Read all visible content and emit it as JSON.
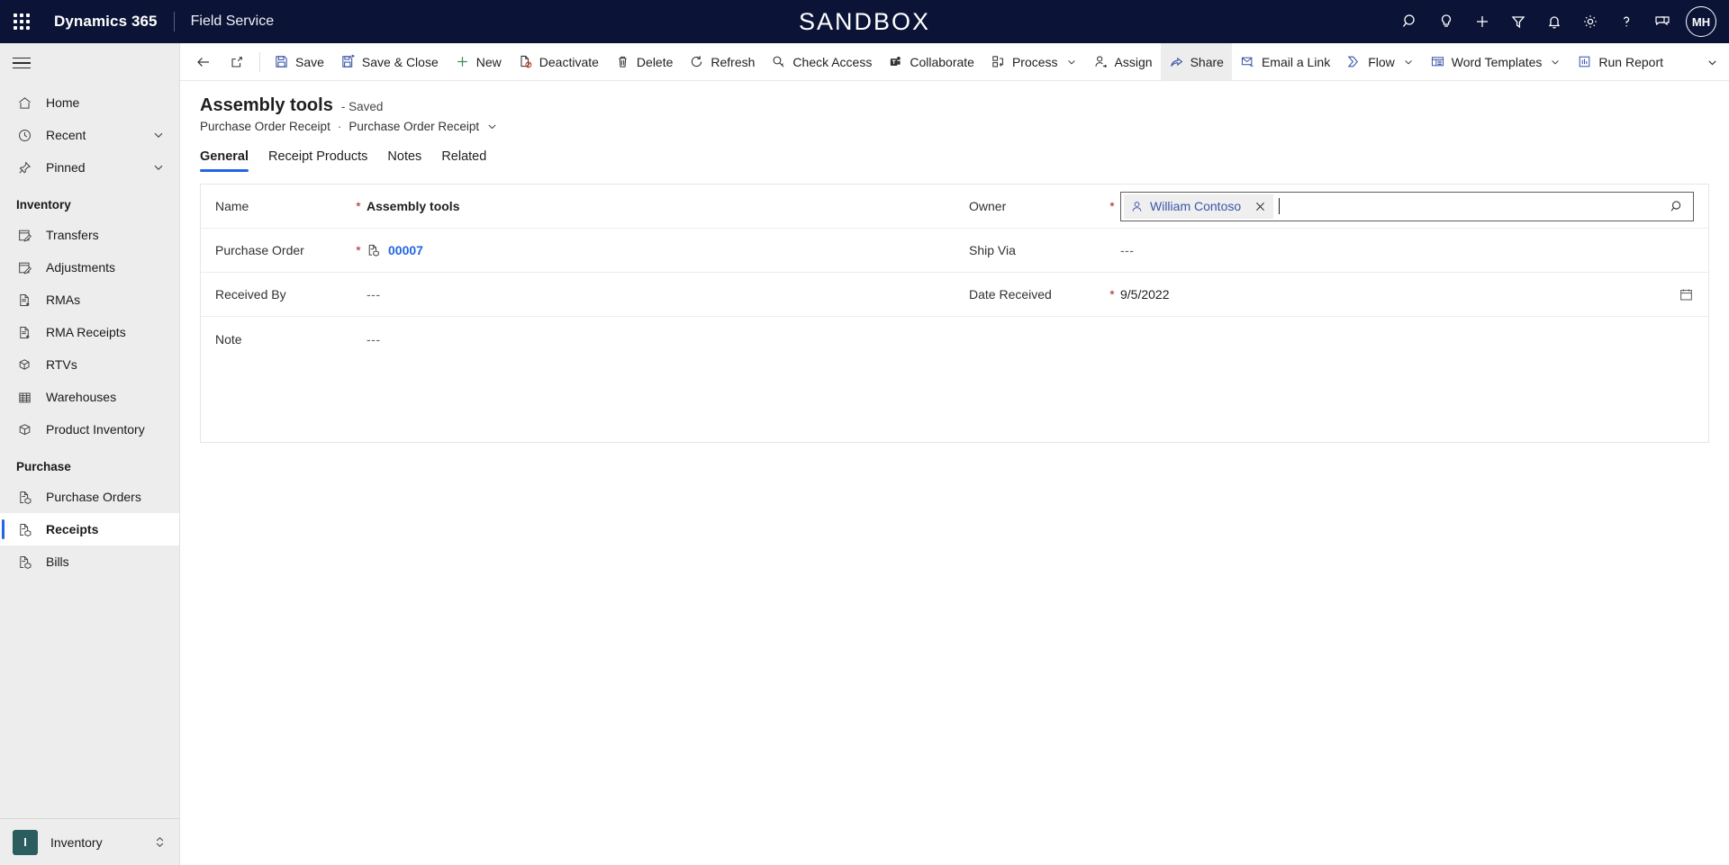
{
  "header": {
    "waffle": "app-launcher",
    "brand": "Dynamics 365",
    "app_name": "Field Service",
    "environment_banner": "SANDBOX",
    "icons": [
      {
        "name": "search-icon",
        "label": "Search"
      },
      {
        "name": "lightbulb-icon",
        "label": "Insights"
      },
      {
        "name": "plus-icon",
        "label": "Quick create"
      },
      {
        "name": "filter-icon",
        "label": "Filter"
      },
      {
        "name": "bell-icon",
        "label": "Notifications"
      },
      {
        "name": "gear-icon",
        "label": "Settings"
      },
      {
        "name": "question-icon",
        "label": "Help"
      },
      {
        "name": "feedback-icon",
        "label": "Feedback"
      }
    ],
    "avatar_initials": "MH"
  },
  "sidebar": {
    "hamburger": "site-map-toggle",
    "items": [
      {
        "label": "Home",
        "icon": "home-icon",
        "chevron": false,
        "selected": false
      },
      {
        "label": "Recent",
        "icon": "clock-icon",
        "chevron": true,
        "selected": false
      },
      {
        "label": "Pinned",
        "icon": "pin-icon",
        "chevron": true,
        "selected": false
      }
    ],
    "groups": [
      {
        "title": "Inventory",
        "items": [
          {
            "label": "Transfers",
            "icon": "transfer-icon",
            "selected": false
          },
          {
            "label": "Adjustments",
            "icon": "adjustment-icon",
            "selected": false
          },
          {
            "label": "RMAs",
            "icon": "rma-icon",
            "selected": false
          },
          {
            "label": "RMA Receipts",
            "icon": "rma-receipt-icon",
            "selected": false
          },
          {
            "label": "RTVs",
            "icon": "rtv-icon",
            "selected": false
          },
          {
            "label": "Warehouses",
            "icon": "warehouse-icon",
            "selected": false
          },
          {
            "label": "Product Inventory",
            "icon": "box-icon",
            "selected": false
          }
        ]
      },
      {
        "title": "Purchase",
        "items": [
          {
            "label": "Purchase Orders",
            "icon": "purchase-order-icon",
            "selected": false
          },
          {
            "label": "Receipts",
            "icon": "receipt-icon",
            "selected": true
          },
          {
            "label": "Bills",
            "icon": "bill-icon",
            "selected": false
          }
        ]
      }
    ],
    "area_switcher": {
      "badge": "I",
      "label": "Inventory",
      "icon": "up-down-chevron-icon"
    }
  },
  "commandbar": {
    "back": "back-arrow-icon",
    "popout": "pop-out-icon",
    "commands": [
      {
        "label": "Save",
        "icon": "save-icon",
        "dropdown": false,
        "active": false
      },
      {
        "label": "Save & Close",
        "icon": "save-close-icon",
        "dropdown": false,
        "active": false
      },
      {
        "label": "New",
        "icon": "plus-icon",
        "dropdown": false,
        "active": false
      },
      {
        "label": "Deactivate",
        "icon": "deactivate-icon",
        "dropdown": false,
        "active": false
      },
      {
        "label": "Delete",
        "icon": "trash-icon",
        "dropdown": false,
        "active": false
      },
      {
        "label": "Refresh",
        "icon": "refresh-icon",
        "dropdown": false,
        "active": false
      },
      {
        "label": "Check Access",
        "icon": "key-icon",
        "dropdown": false,
        "active": false
      },
      {
        "label": "Collaborate",
        "icon": "teams-icon",
        "dropdown": false,
        "active": false
      },
      {
        "label": "Process",
        "icon": "process-icon",
        "dropdown": true,
        "active": false
      },
      {
        "label": "Assign",
        "icon": "assign-icon",
        "dropdown": false,
        "active": false
      },
      {
        "label": "Share",
        "icon": "share-icon",
        "dropdown": false,
        "active": true
      },
      {
        "label": "Email a Link",
        "icon": "email-link-icon",
        "dropdown": false,
        "active": false
      },
      {
        "label": "Flow",
        "icon": "flow-icon",
        "dropdown": true,
        "active": false
      },
      {
        "label": "Word Templates",
        "icon": "word-template-icon",
        "dropdown": true,
        "active": false
      },
      {
        "label": "Run Report",
        "icon": "report-icon",
        "dropdown": true,
        "active": false
      }
    ],
    "overflow": "chevron-down-icon"
  },
  "record": {
    "title": "Assembly tools",
    "status": "- Saved",
    "breadcrumb_entity": "Purchase Order Receipt",
    "breadcrumb_separator": "·",
    "breadcrumb_form": "Purchase Order Receipt"
  },
  "tabs": [
    {
      "label": "General",
      "active": true
    },
    {
      "label": "Receipt Products",
      "active": false
    },
    {
      "label": "Notes",
      "active": false
    },
    {
      "label": "Related",
      "active": false
    }
  ],
  "form": {
    "left": [
      {
        "label": "Name",
        "required": true,
        "value": "Assembly tools",
        "type": "text-bold"
      },
      {
        "label": "Purchase Order",
        "required": true,
        "value": "00007",
        "type": "lookup-link"
      },
      {
        "label": "Received By",
        "required": false,
        "value": "---",
        "type": "empty"
      },
      {
        "label": "Note",
        "required": false,
        "value": "---",
        "type": "empty"
      }
    ],
    "right": [
      {
        "label": "Owner",
        "required": true,
        "value": "William Contoso",
        "type": "lookup-focused"
      },
      {
        "label": "Ship Via",
        "required": false,
        "value": "---",
        "type": "empty"
      },
      {
        "label": "Date Received",
        "required": true,
        "value": "9/5/2022",
        "type": "date"
      }
    ]
  },
  "colors": {
    "header_bg": "#0b1437",
    "accent": "#2266e3",
    "link": "#2266e3",
    "required": "#a4262c",
    "sidebar_bg": "#ededed",
    "area_badge": "#2b5c5e"
  }
}
